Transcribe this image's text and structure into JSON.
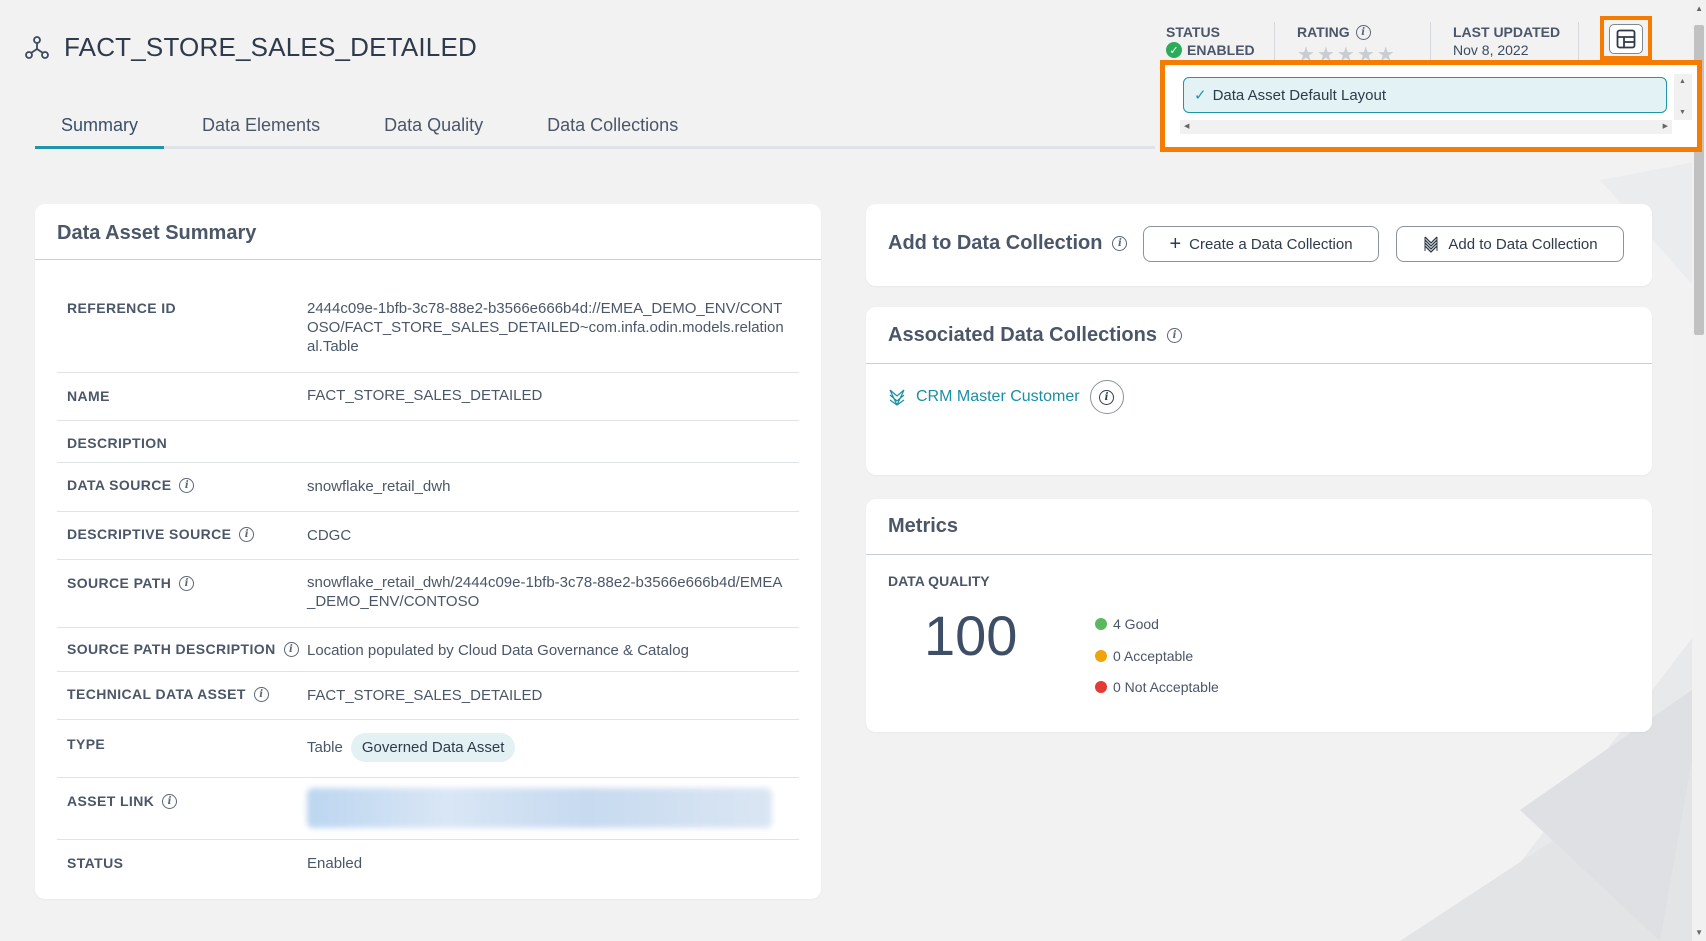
{
  "page": {
    "title": "FACT_STORE_SALES_DETAILED"
  },
  "tabs": [
    {
      "label": "Summary",
      "active": true
    },
    {
      "label": "Data Elements",
      "active": false
    },
    {
      "label": "Data Quality",
      "active": false
    },
    {
      "label": "Data Collections",
      "active": false
    }
  ],
  "header_meta": {
    "status_label": "STATUS",
    "status_value": "ENABLED",
    "rating_label": "RATING",
    "rating_value": 0,
    "rating_stars": "★★★★★",
    "last_updated_label": "LAST UPDATED",
    "last_updated_value": "Nov 8, 2022"
  },
  "layout_menu": {
    "items": [
      {
        "label": "Data Asset Default Layout",
        "selected": true
      }
    ]
  },
  "summary": {
    "title": "Data Asset Summary",
    "rows": [
      {
        "label": "REFERENCE ID",
        "value": "2444c09e-1bfb-3c78-88e2-b3566e666b4d://EMEA_DEMO_ENV/CONTOSO/FACT_STORE_SALES_DETAILED~com.infa.odin.models.relational.Table"
      },
      {
        "label": "NAME",
        "value": "FACT_STORE_SALES_DETAILED"
      },
      {
        "label": "DESCRIPTION",
        "value": ""
      },
      {
        "label": "DATA SOURCE",
        "value": "snowflake_retail_dwh"
      },
      {
        "label": "DESCRIPTIVE SOURCE",
        "value": "CDGC"
      },
      {
        "label": "SOURCE PATH",
        "value": "snowflake_retail_dwh/2444c09e-1bfb-3c78-88e2-b3566e666b4d/EMEA_DEMO_ENV/CONTOSO"
      },
      {
        "label": "SOURCE PATH DESCRIPTION",
        "value": "Location populated by Cloud Data Governance & Catalog"
      },
      {
        "label": "TECHNICAL DATA ASSET",
        "value": "FACT_STORE_SALES_DETAILED"
      },
      {
        "label": "TYPE",
        "value": "Table",
        "pill": "Governed Data Asset"
      },
      {
        "label": "ASSET LINK",
        "value": ""
      },
      {
        "label": "STATUS",
        "value": "Enabled"
      }
    ]
  },
  "add_collection": {
    "title": "Add to Data Collection",
    "create_button": "Create a Data Collection",
    "add_button": "Add to Data Collection"
  },
  "associated": {
    "title": "Associated Data Collections",
    "items": [
      {
        "label": "CRM Master Customer"
      }
    ]
  },
  "metrics": {
    "title": "Metrics",
    "data_quality_label": "DATA QUALITY",
    "score": "100",
    "legend": [
      {
        "label": "4 Good",
        "color": "#5cb85c"
      },
      {
        "label": "0 Acceptable",
        "color": "#f0a30a"
      },
      {
        "label": "0 Not Acceptable",
        "color": "#e53935"
      }
    ]
  }
}
